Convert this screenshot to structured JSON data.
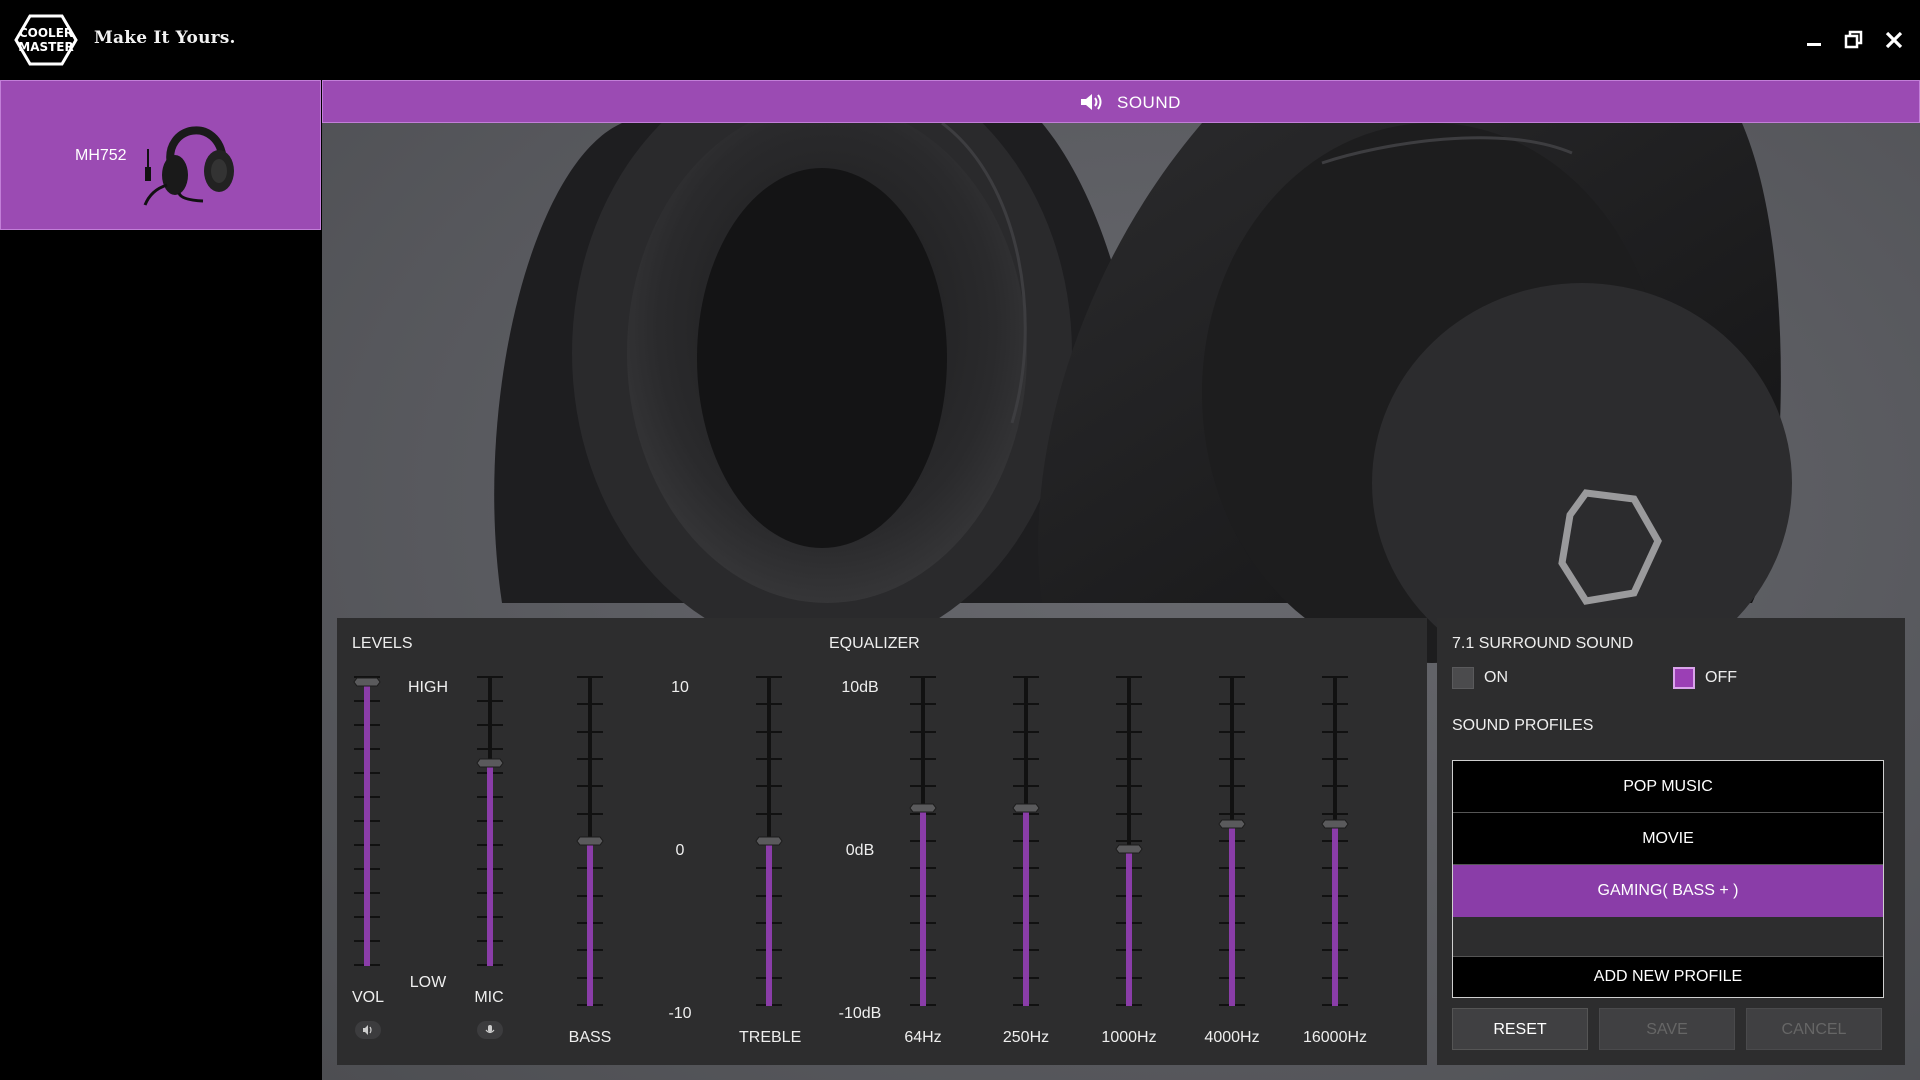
{
  "app": {
    "logo_text_line1": "COOLER",
    "logo_text_line2": "MASTER",
    "tagline": "Make It Yours."
  },
  "window_controls": [
    "minimize-icon",
    "restore-icon",
    "close-icon"
  ],
  "sidebar": {
    "device_name": "MH752"
  },
  "tab": {
    "label": "SOUND",
    "icon": "speaker-icon"
  },
  "levels": {
    "title": "LEVELS",
    "high_label": "HIGH",
    "low_label": "LOW",
    "vol_label": "VOL",
    "mic_label": "MIC",
    "vol_level": 0.98,
    "mic_level": 0.7
  },
  "tone": {
    "bass_label": "BASS",
    "treble_label": "TREBLE",
    "scale_top": "10",
    "scale_mid": "0",
    "scale_bottom": "-10",
    "bass_value": 0,
    "treble_value": 0
  },
  "equalizer": {
    "title": "EQUALIZER",
    "scale_top": "10dB",
    "scale_mid": "0dB",
    "scale_bottom": "-10dB",
    "bands": [
      {
        "label": "64Hz",
        "value": 2
      },
      {
        "label": "250Hz",
        "value": 2
      },
      {
        "label": "1000Hz",
        "value": -0.5
      },
      {
        "label": "4000Hz",
        "value": 1
      },
      {
        "label": "16000Hz",
        "value": 1
      }
    ]
  },
  "surround": {
    "title": "7.1 SURROUND SOUND",
    "on_label": "ON",
    "off_label": "OFF",
    "selected": "off"
  },
  "profiles": {
    "title": "SOUND PROFILES",
    "items": [
      "POP MUSIC",
      "MOVIE",
      "GAMING( BASS + )"
    ],
    "active_index": 2,
    "add_label": "ADD NEW PROFILE"
  },
  "buttons": {
    "reset": "RESET",
    "save": "SAVE",
    "cancel": "CANCEL"
  },
  "colors": {
    "accent": "#9b4bb3",
    "accent_dark": "#8a3da8",
    "panel": "#2d2d2e"
  }
}
